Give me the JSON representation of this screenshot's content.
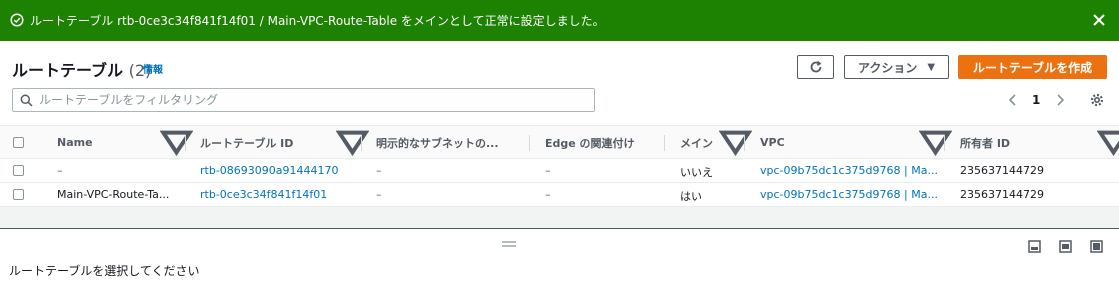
{
  "flash": {
    "message": "ルートテーブル rtb-0ce3c34f841f14f01 / Main-VPC-Route-Table をメインとして正常に設定しました。",
    "icon": "success-check-icon",
    "color": "#1d8102"
  },
  "header": {
    "title": "ルートテーブル",
    "count": "(2)",
    "info": "情報",
    "actions_label": "アクション",
    "create_label": "ルートテーブルを作成",
    "create_color": "#ec7211"
  },
  "search": {
    "placeholder": "ルートテーブルをフィルタリング",
    "value": ""
  },
  "pagination": {
    "current_page": "1"
  },
  "table": {
    "columns": [
      "Name",
      "ルートテーブル ID",
      "明示的なサブネットの...",
      "Edge の関連付け",
      "メイン",
      "VPC",
      "所有者 ID"
    ],
    "rows": [
      {
        "name": "–",
        "route_table_id": "rtb-08693090a91444170",
        "explicit_subnets": "–",
        "edge_associations": "–",
        "main": "いいえ",
        "vpc": "vpc-09b75dc1c375d9768 | Ma...",
        "owner_id": "235637144729"
      },
      {
        "name": "Main-VPC-Route-Ta...",
        "route_table_id": "rtb-0ce3c34f841f14f01",
        "explicit_subnets": "–",
        "edge_associations": "–",
        "main": "はい",
        "vpc": "vpc-09b75dc1c375d9768 | Ma...",
        "owner_id": "235637144729"
      }
    ]
  },
  "split_panel": {
    "message": "ルートテーブルを選択してください"
  },
  "colors": {
    "link": "#0073bb",
    "text": "#16191f",
    "muted": "#545b64"
  }
}
